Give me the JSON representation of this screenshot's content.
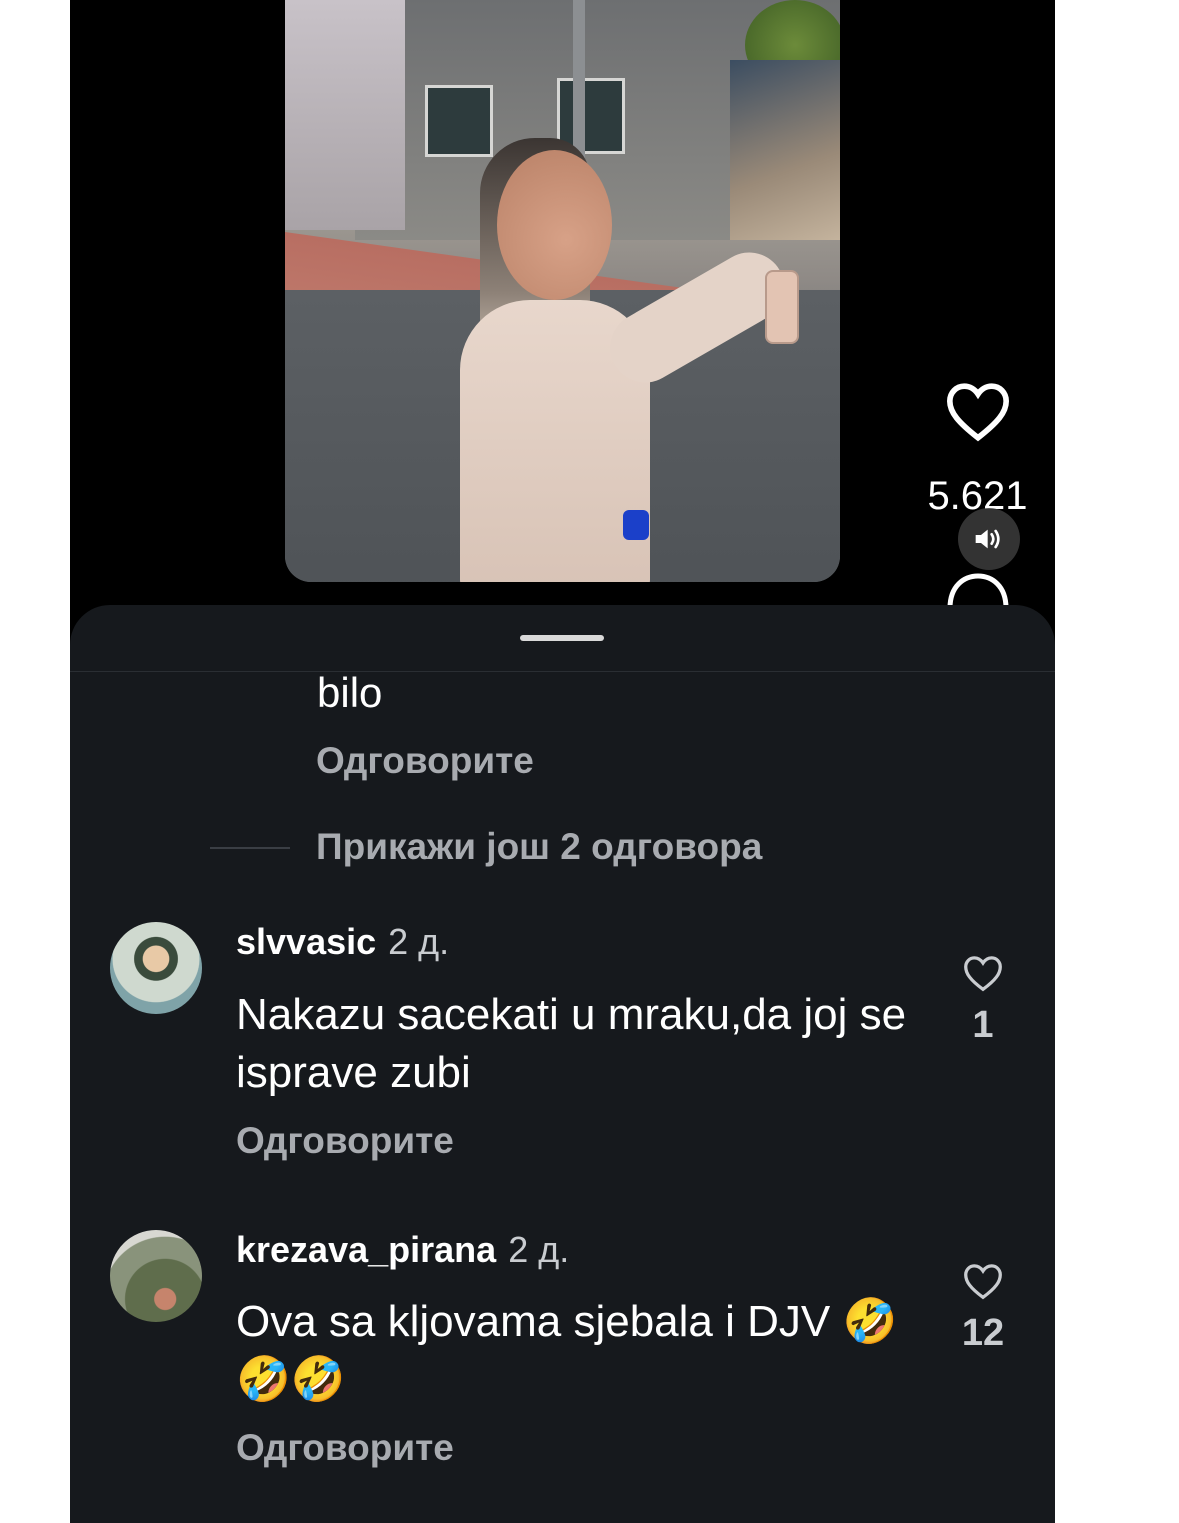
{
  "video": {
    "likes": "5.621"
  },
  "thread": {
    "prev_comment_tail": "bilo",
    "prev_reply_label": "Одговорите",
    "show_more_replies": "Прикажи још 2 одговора"
  },
  "comments": [
    {
      "username": "slvvasic",
      "time": "2 д.",
      "text": "Nakazu sacekati u mraku,da joj se isprave zubi",
      "likes": "1",
      "reply_label": "Одговорите"
    },
    {
      "username": "krezava_pirana",
      "time": "2 д.",
      "text": "Ova sa kljovama sjebala i DJV 🤣🤣🤣",
      "likes": "12",
      "reply_label": "Одговорите"
    }
  ],
  "icons": {
    "like": "heart-icon",
    "sound": "speaker-icon",
    "comment": "comment-icon",
    "comment_like": "heart-outline-icon"
  },
  "colors": {
    "app_bg": "#000000",
    "sheet_bg": "#16191d",
    "secondary_text": "#a8abb0"
  }
}
